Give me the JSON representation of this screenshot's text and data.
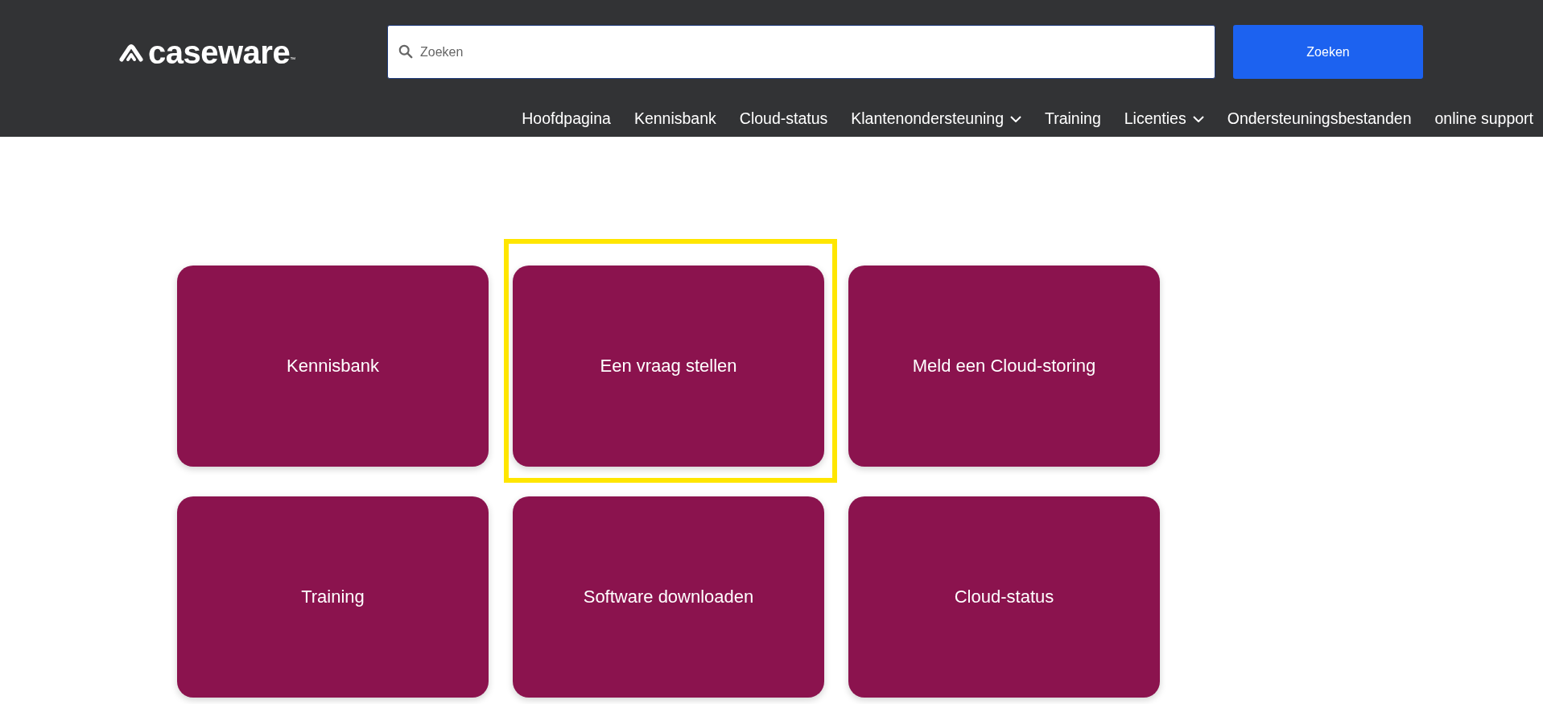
{
  "header": {
    "logo": {
      "text": "caseware",
      "trademark": "™"
    },
    "search": {
      "placeholder": "Zoeken",
      "button": "Zoeken"
    },
    "nav": [
      {
        "label": "Hoofdpagina",
        "has_menu": false
      },
      {
        "label": "Kennisbank",
        "has_menu": false
      },
      {
        "label": "Cloud-status",
        "has_menu": false
      },
      {
        "label": "Klantenondersteuning",
        "has_menu": true
      },
      {
        "label": "Training",
        "has_menu": false
      },
      {
        "label": "Licenties",
        "has_menu": true
      },
      {
        "label": "Ondersteuningsbestanden",
        "has_menu": false
      },
      {
        "label": "online support",
        "has_menu": false
      }
    ]
  },
  "tiles": [
    {
      "label": "Kennisbank",
      "highlighted": false
    },
    {
      "label": "Een vraag stellen",
      "highlighted": true
    },
    {
      "label": "Meld een Cloud-storing",
      "highlighted": false
    },
    {
      "label": "Training",
      "highlighted": false
    },
    {
      "label": "Software downloaden",
      "highlighted": false
    },
    {
      "label": "Cloud-status",
      "highlighted": false
    }
  ]
}
